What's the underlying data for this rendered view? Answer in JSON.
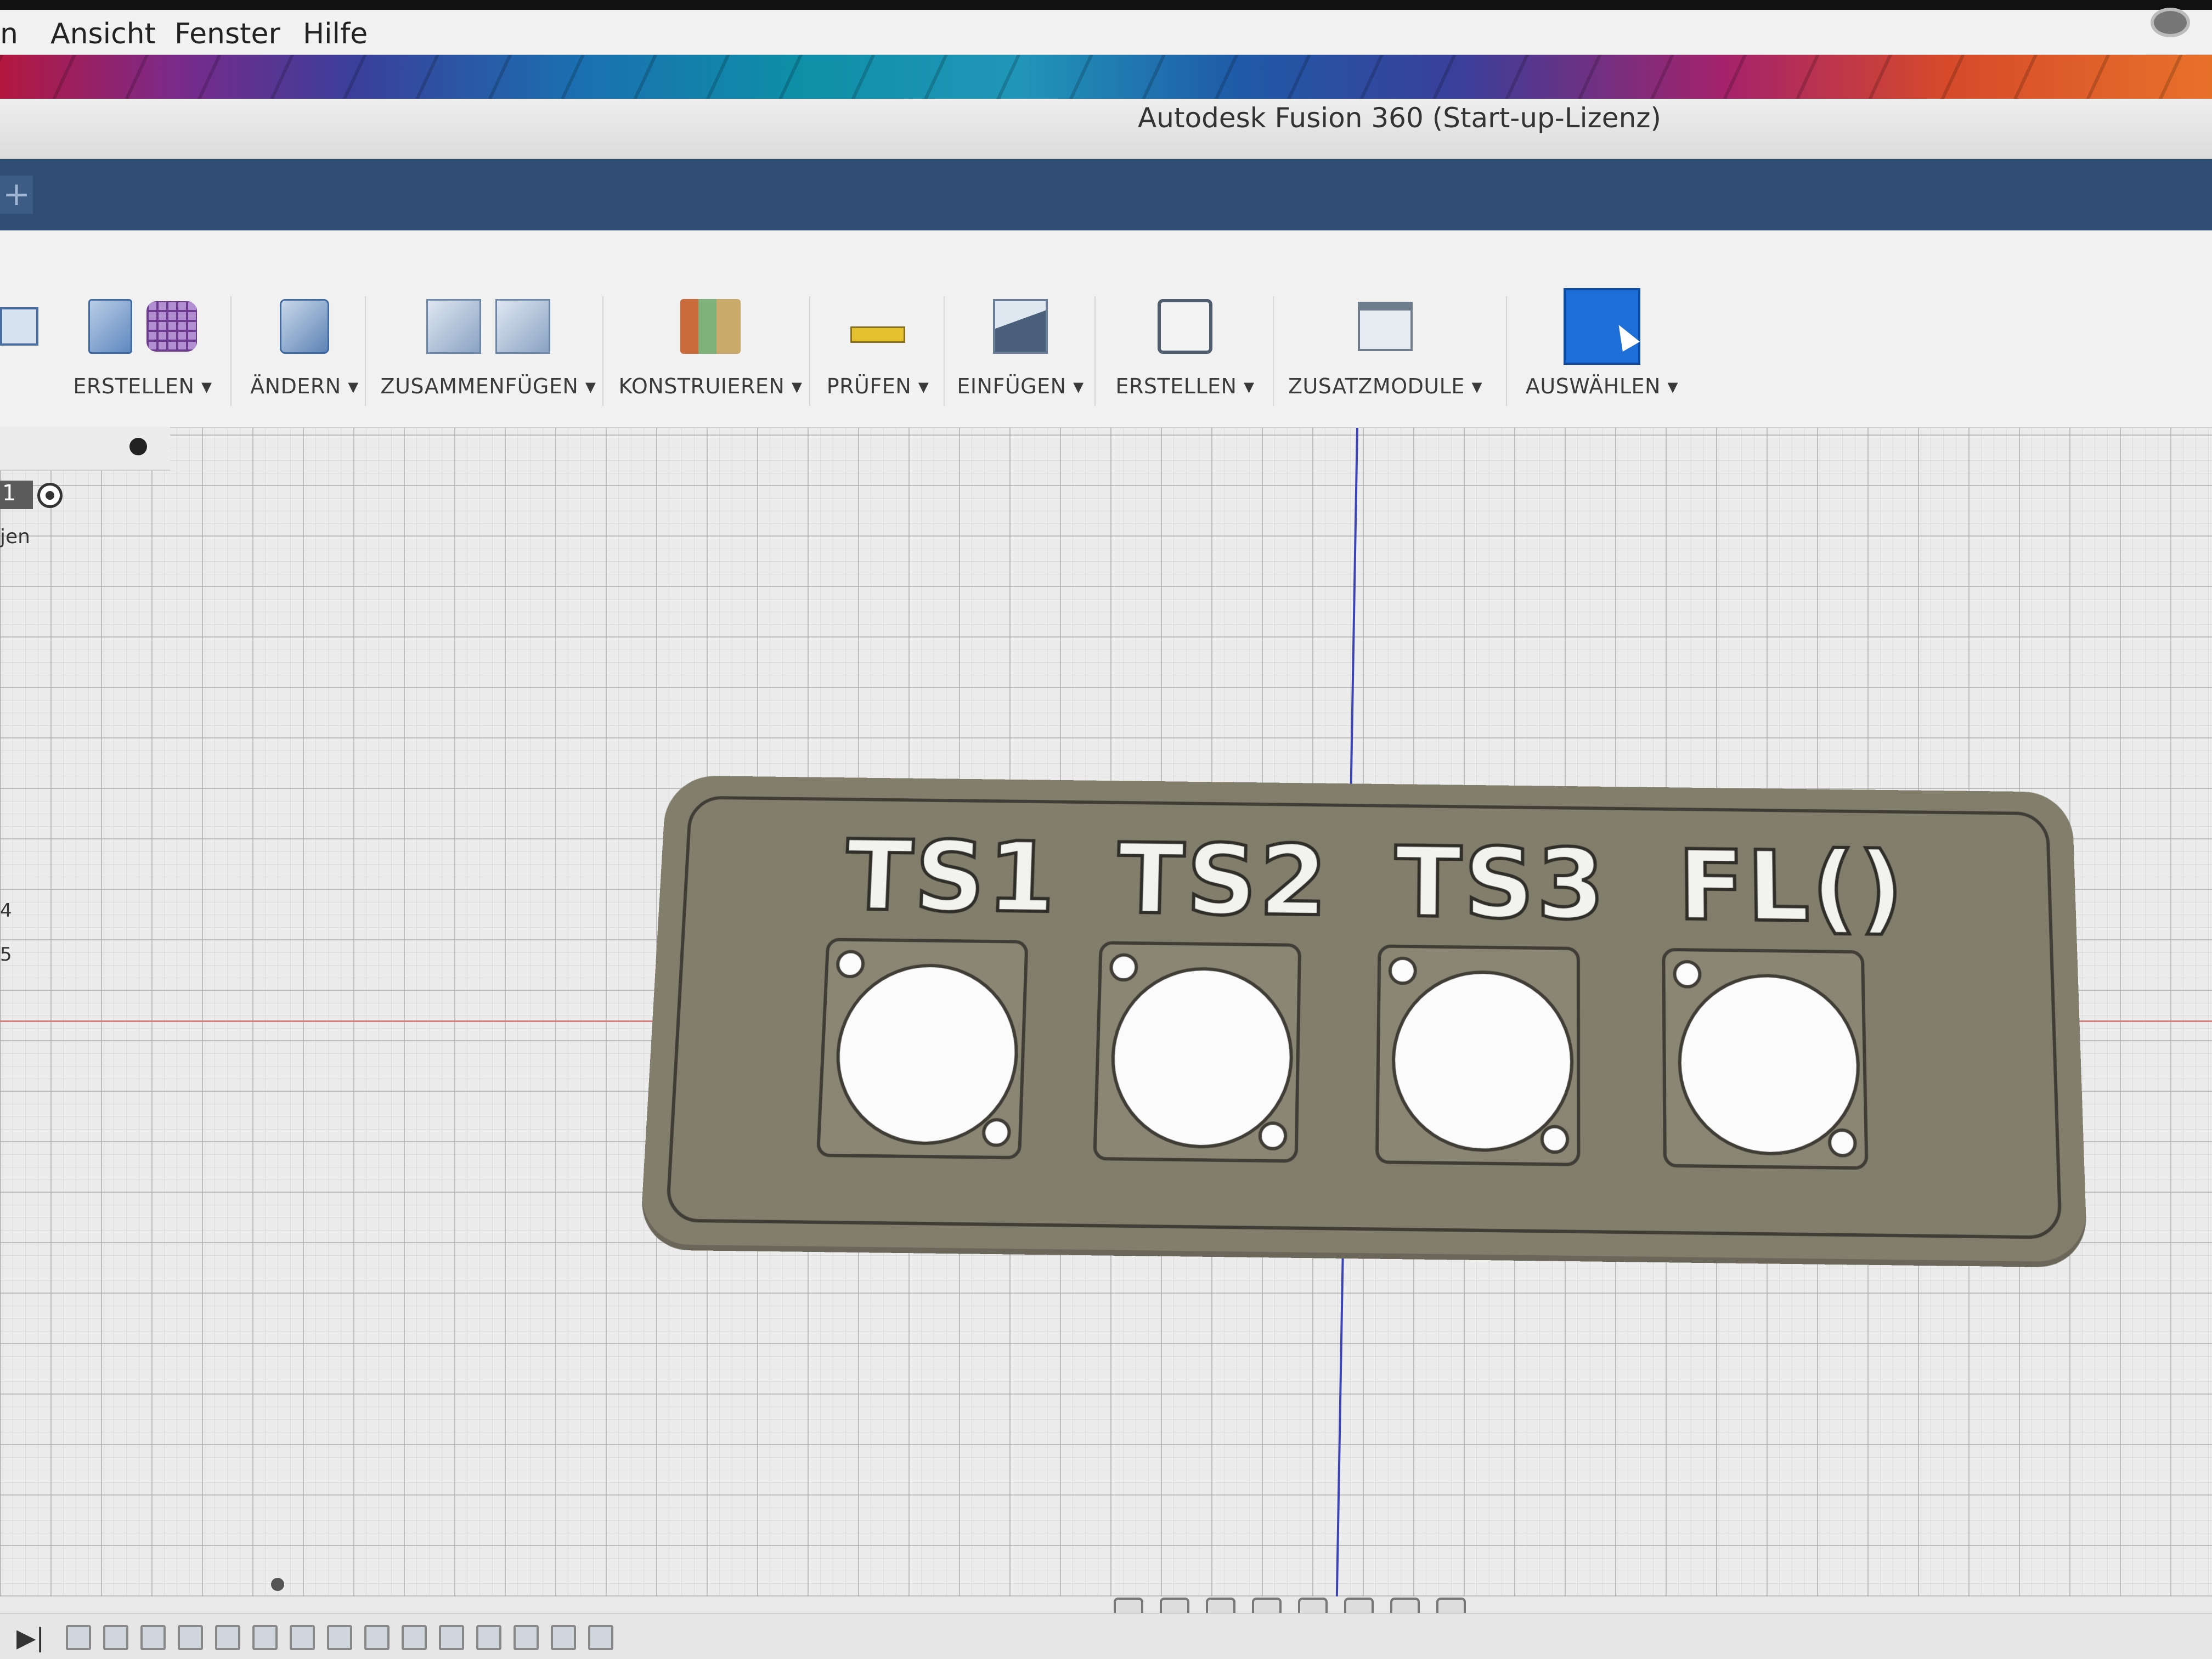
{
  "menubar": {
    "items": [
      "n",
      "Ansicht",
      "Fenster",
      "Hilfe"
    ]
  },
  "window": {
    "title": "Autodesk Fusion 360 (Start-up-Lizenz)"
  },
  "tabbar": {
    "new_tab_symbol": "+"
  },
  "toolbar": {
    "groups": [
      {
        "label": "ERSTELLEN ▾",
        "icons": [
          "extrude-icon",
          "form-icon"
        ]
      },
      {
        "label": "ÄNDERN ▾",
        "icons": [
          "press-pull-icon"
        ]
      },
      {
        "label": "ZUSAMMENFÜGEN ▾",
        "icons": [
          "new-component-icon",
          "joint-icon"
        ]
      },
      {
        "label": "KONSTRUIEREN ▾",
        "icons": [
          "plane-icon"
        ]
      },
      {
        "label": "PRÜFEN ▾",
        "icons": [
          "measure-icon"
        ]
      },
      {
        "label": "EINFÜGEN ▾",
        "icons": [
          "insert-image-icon"
        ]
      },
      {
        "label": "ERSTELLEN ▾",
        "icons": [
          "3d-print-icon"
        ]
      },
      {
        "label": "ZUSATZMODULE ▾",
        "icons": [
          "scripts-icon"
        ]
      },
      {
        "label": "AUSWÄHLEN ▾",
        "icons": [
          "select-icon"
        ]
      }
    ]
  },
  "browser": {
    "row1_number": "1",
    "row2_text": "jen",
    "row_n4": "4",
    "row_n5": "5"
  },
  "plate": {
    "labels": [
      "TS1",
      "TS2",
      "TS3",
      "FL()"
    ]
  },
  "colors": {
    "tabbar": "#2f4c73",
    "plate": "#827e6c",
    "axis_blue": "#3b43b8",
    "axis_red": "#d28080",
    "select_button": "#1d6ed6"
  }
}
